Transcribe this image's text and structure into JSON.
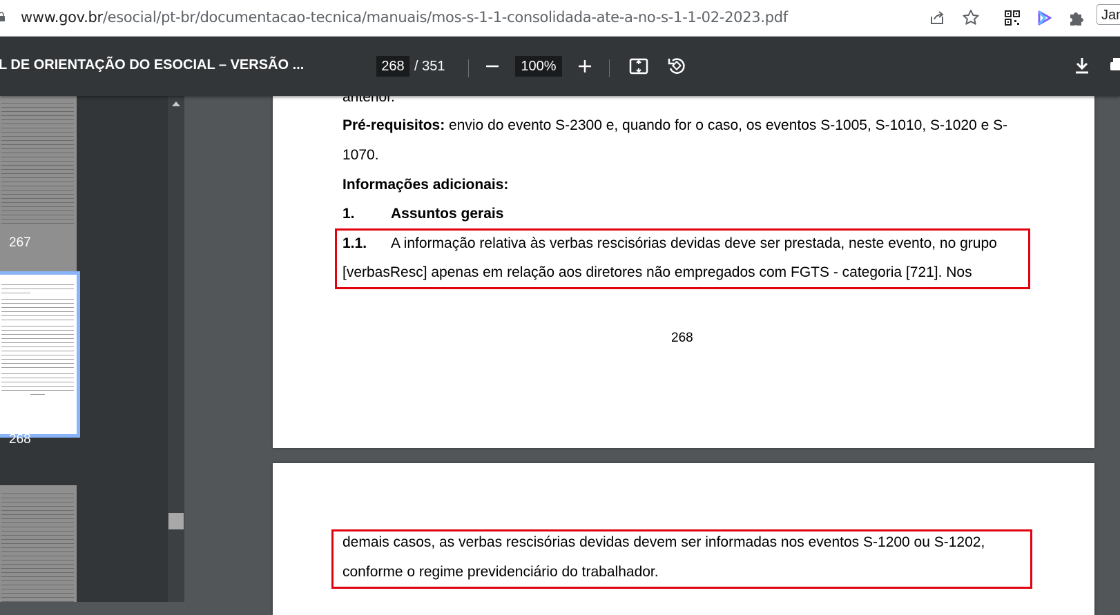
{
  "browser": {
    "url_host": "www.gov.br",
    "url_path": "/esocial/pt-br/documentacao-tecnica/manuais/mos-s-1-1-consolidada-ate-a-no-s-1-1-02-2023.pdf",
    "profile_label": "Jan"
  },
  "toolbar": {
    "title": "L DE ORIENTAÇÃO DO ESOCIAL – VERSÃO ...",
    "page_current": "268",
    "page_total": "/ 351",
    "zoom": "100%"
  },
  "sidebar": {
    "thumbnails": [
      {
        "label": "267"
      },
      {
        "label": "268"
      }
    ]
  },
  "page268": {
    "line0": "anterior.",
    "prereq_label": "Pré-requisitos:",
    "prereq_text": " envio do evento S-2300 e, quando for o caso, os eventos S-1005, S-1010, S-1020 e S-",
    "prereq_text2": "1070.",
    "info_heading": "Informações adicionais:",
    "section_num": "1.",
    "section_title": "Assuntos gerais",
    "item_num": "1.1.",
    "item_line1": "A informação relativa às verbas rescisórias devidas deve ser prestada, neste evento, no grupo",
    "item_line2": "[verbasResc] apenas em relação aos diretores não empregados com FGTS - categoria [721]. Nos",
    "page_number": "268"
  },
  "page269": {
    "line1": "demais casos, as verbas rescisórias devidas devem ser informadas nos eventos S-1200 ou S-1202,",
    "line2": "conforme o regime previdenciário do trabalhador."
  },
  "colors": {
    "highlight": "#e3000f",
    "toolbar": "#323639",
    "viewer_bg": "#525659",
    "active_thumb_border": "#8ab4f8"
  }
}
